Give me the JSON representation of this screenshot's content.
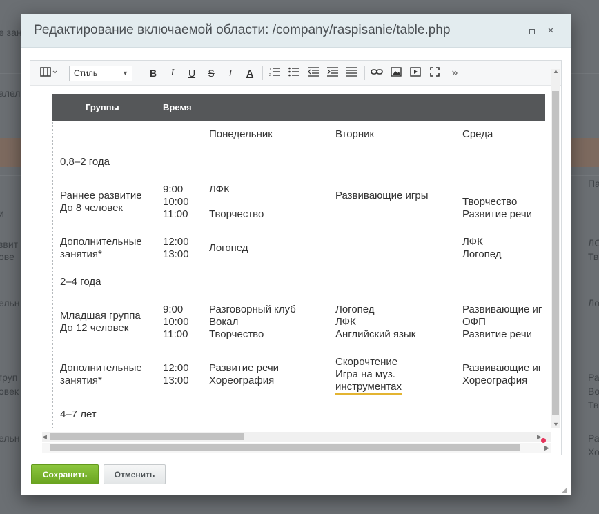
{
  "background": {
    "fragments": [
      "е зан",
      "алел",
      "Па",
      "и",
      "ЛС",
      "звит",
      "ове",
      "Тв",
      "ельн",
      "Ло",
      "груп",
      "Ра",
      "овек",
      "Во",
      "Тв",
      "ельн",
      "Ра",
      "Хо"
    ]
  },
  "dialog": {
    "title": "Редактирование включаемой области: /company/raspisanie/table.php",
    "maximize_label": "maximize",
    "close_label": "×"
  },
  "toolbar": {
    "style_label": "Стиль",
    "bold": "B",
    "italic": "I",
    "underline": "U",
    "strike": "S",
    "clear_format": "T",
    "font_color": "A",
    "more": "»"
  },
  "table": {
    "headers": [
      "Группы",
      "Время"
    ],
    "days": [
      "Понедельник",
      "Вторник",
      "Среда"
    ],
    "sections": [
      {
        "title": "0,8–2 года",
        "rows": [
          {
            "group": [
              "Раннее развитие",
              "До 8 человек"
            ],
            "time": [
              "9:00",
              "10:00",
              "11:00"
            ],
            "mon": [
              "ЛФК",
              "",
              "Творчество"
            ],
            "tue": [
              "Развивающие игры"
            ],
            "wed": [
              "Творчество",
              "Развитие речи"
            ]
          },
          {
            "group": [
              "Дополнительные",
              "занятия*"
            ],
            "time": [
              "12:00",
              "13:00"
            ],
            "mon": [
              "Логопед"
            ],
            "tue": [],
            "wed": [
              "ЛФК",
              "Логопед"
            ]
          }
        ]
      },
      {
        "title": "2–4 года",
        "rows": [
          {
            "group": [
              "Младшая группа",
              "До 12 человек"
            ],
            "time": [
              "9:00",
              "10:00",
              "11:00"
            ],
            "mon": [
              "Разговорный клуб",
              "Вокал",
              "Творчество"
            ],
            "tue": [
              "Логопед",
              "ЛФК",
              "Английский язык"
            ],
            "wed": [
              "Развивающие иг",
              "ОФП",
              "Развитие речи"
            ]
          },
          {
            "group": [
              "Дополнительные",
              "занятия*"
            ],
            "time": [
              "12:00",
              "13:00"
            ],
            "mon": [
              "Развитие речи",
              "Хореография"
            ],
            "tue": [
              "Скорочтение",
              "Игра на муз.",
              "инструментах"
            ],
            "wed": [
              "Развивающие иг",
              "Хореография"
            ]
          }
        ]
      },
      {
        "title": "4–7 лет",
        "rows": []
      }
    ]
  },
  "buttons": {
    "save": "Сохранить",
    "cancel": "Отменить"
  },
  "colors": {
    "save_green": "#7ab52f",
    "header_dark": "#555759",
    "spellcheck_underline": "#e3b431"
  }
}
